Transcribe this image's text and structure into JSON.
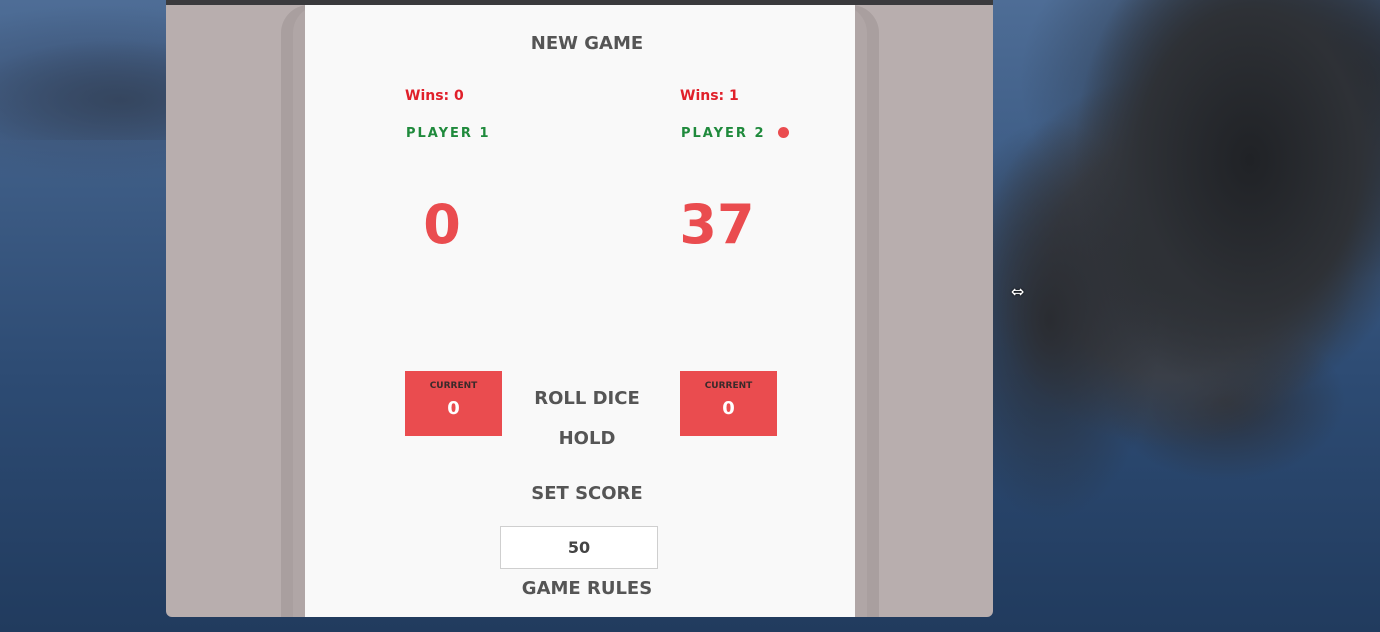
{
  "game": {
    "new_game_label": "NEW GAME",
    "roll_dice_label": "ROLL DICE",
    "hold_label": "HOLD",
    "set_score_label": "SET SCORE",
    "game_rules_label": "GAME RULES",
    "target_score_value": "50",
    "active_player": "player2",
    "active_color": "#ea4c4f"
  },
  "players": [
    {
      "wins_text": "Wins: 0",
      "name": "PLAYER 1",
      "score": "0",
      "current_label": "CURRENT",
      "current_value": "0"
    },
    {
      "wins_text": "Wins: 1",
      "name": "PLAYER 2",
      "score": "37",
      "current_label": "CURRENT",
      "current_value": "0"
    }
  ],
  "desktop": {
    "cursor_icon": "resize-horizontal-cursor-icon"
  }
}
